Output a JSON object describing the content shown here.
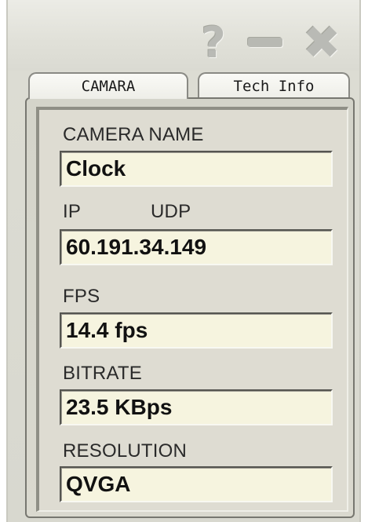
{
  "titlebar": {
    "help_glyph": "?",
    "close_glyph": "✖"
  },
  "tabs": [
    {
      "label": "CAMARA",
      "active": true
    },
    {
      "label": "Tech Info",
      "active": false
    }
  ],
  "fields": {
    "camera_name": {
      "label": "CAMERA NAME",
      "value": "Clock"
    },
    "ip": {
      "label": "IP",
      "label2": "UDP",
      "value": "60.191.34.149"
    },
    "fps": {
      "label": "FPS",
      "value": "14.4 fps"
    },
    "bitrate": {
      "label": "BITRATE",
      "value": "23.5 KBps"
    },
    "resolution": {
      "label": "RESOLUTION",
      "value": "QVGA"
    }
  }
}
